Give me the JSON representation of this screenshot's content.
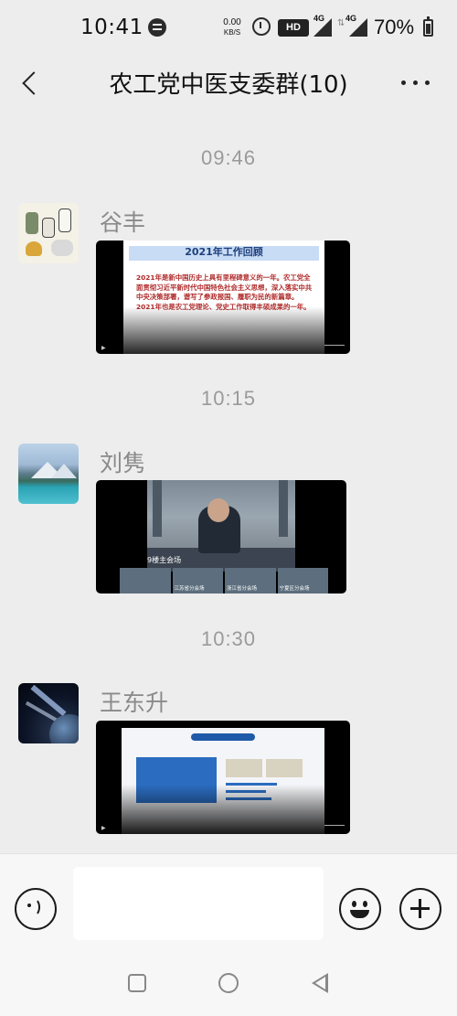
{
  "status_bar": {
    "time": "10:41",
    "net_speed": "0.00",
    "net_unit": "KB/S",
    "hd_label": "HD",
    "network_label_1": "4G",
    "network_label_2": "4G",
    "battery": "70%",
    "icons": [
      "message-icon",
      "alarm-icon",
      "signal-icon",
      "battery-icon"
    ]
  },
  "header": {
    "title": "农工党中医支委群(10)",
    "back_icon": "chevron-left-icon",
    "more_icon": "more-horizontal-icon"
  },
  "messages": [
    {
      "timestamp": "09:46",
      "sender": "谷丰",
      "video": {
        "slide_title": "2021年工作回顾",
        "slide_text": "2021年是新中国历史上具有里程碑意义的一年。农工党全面贯彻习近平新时代中国特色社会主义思想，深入落实中共中央决策部署，谱写了参政报国、履职为民的新篇章。2021年也是农工党理论、党史工作取得丰硕成果的一年。"
      }
    },
    {
      "timestamp": "10:15",
      "sender": "刘隽",
      "video": {
        "main_label": "9楼主会场",
        "thumb_labels": [
          "",
          "江苏省分会场",
          "浙江省分会场",
          "宁夏区分会场"
        ]
      }
    },
    {
      "timestamp": "10:30",
      "sender": "王东升",
      "video": {}
    }
  ],
  "input_bar": {
    "voice_icon": "voice-icon",
    "emoji_icon": "emoji-icon",
    "plus_icon": "plus-icon",
    "text_value": ""
  },
  "nav_bar": {
    "icons": [
      "recents-icon",
      "home-icon",
      "back-icon"
    ]
  }
}
